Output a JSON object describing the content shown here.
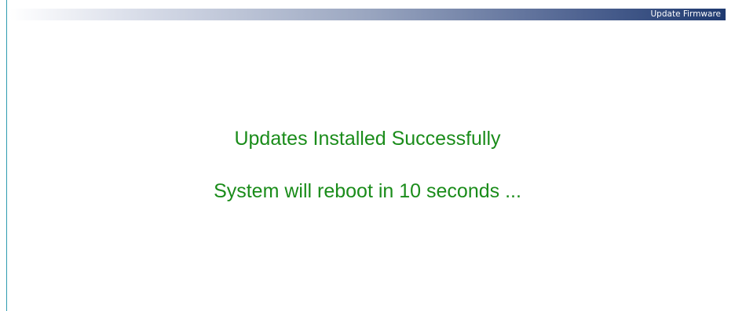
{
  "header": {
    "title": "Update Firmware"
  },
  "status": {
    "success_message": "Updates Installed Successfully",
    "reboot_message": "System will reboot in 10 seconds ..."
  },
  "colors": {
    "message_text": "#1a8c1a",
    "header_gradient_end": "#1f3a70",
    "left_rule": "#2f9bb0"
  }
}
